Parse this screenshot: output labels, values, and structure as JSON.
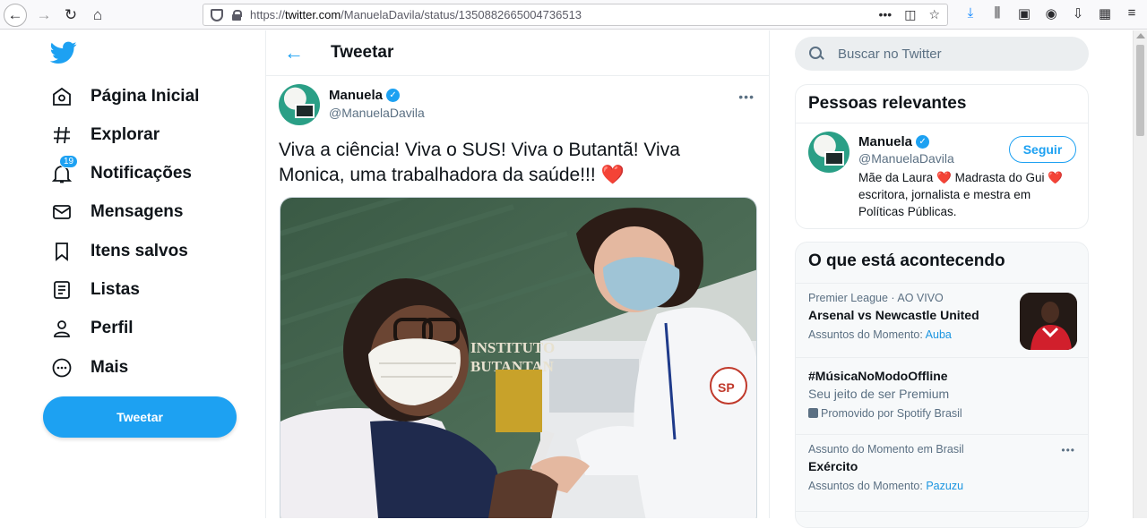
{
  "browser": {
    "url_prefix": "https://",
    "url_host": "twitter.com",
    "url_path": "/ManuelaDavila/status/1350882665004736513"
  },
  "sidebar": {
    "items": [
      {
        "label": "Página Inicial",
        "icon": "home-icon"
      },
      {
        "label": "Explorar",
        "icon": "hashtag-icon"
      },
      {
        "label": "Notificações",
        "icon": "bell-icon",
        "badge": "19"
      },
      {
        "label": "Mensagens",
        "icon": "envelope-icon"
      },
      {
        "label": "Itens salvos",
        "icon": "bookmark-icon"
      },
      {
        "label": "Listas",
        "icon": "list-icon"
      },
      {
        "label": "Perfil",
        "icon": "person-icon"
      },
      {
        "label": "Mais",
        "icon": "more-circle-icon"
      }
    ],
    "tweet_button": "Tweetar"
  },
  "main": {
    "header_title": "Tweetar",
    "author_name": "Manuela",
    "author_handle": "@ManuelaDavila",
    "tweet_text": "Viva a ciência! Viva o SUS! Viva o Butantã! Viva Monica, uma trabalhadora da saúde!!!",
    "tweet_emoji": "❤️",
    "image_text_line1": "INSTITUTO",
    "image_text_line2": "BUTANTAN",
    "image_emblem": "SP"
  },
  "right": {
    "search_placeholder": "Buscar no Twitter",
    "people_title": "Pessoas relevantes",
    "person": {
      "name": "Manuela",
      "handle": "@ManuelaDavila",
      "bio_part1": "Mãe da Laura",
      "bio_part2": "Madrasta do Gui",
      "bio_part3": "escritora, jornalista e mestra em Políticas Públicas.",
      "follow_label": "Seguir"
    },
    "trends_title": "O que está acontecendo",
    "trends": [
      {
        "meta": "Premier League · AO VIVO",
        "title": "Arsenal vs Newcastle United",
        "foot_label": "Assuntos do Momento:",
        "foot_link": "Auba"
      },
      {
        "title": "#MúsicaNoModoOffline",
        "sub": "Seu jeito de ser Premium",
        "foot_label": "Promovido por Spotify Brasil"
      },
      {
        "meta": "Assunto do Momento em Brasil",
        "title": "Exército",
        "foot_label": "Assuntos do Momento:",
        "foot_link": "Pazuzu"
      }
    ]
  },
  "colors": {
    "accent": "#1da1f2",
    "heart": "#e0245e",
    "text": "#0f1419",
    "muted": "#5b7083"
  }
}
